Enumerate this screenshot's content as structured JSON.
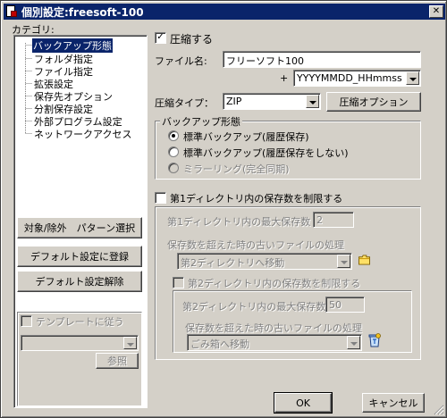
{
  "window": {
    "title": "個別設定:freesoft-100",
    "close_icon": "close-icon"
  },
  "category": {
    "label": "カテゴリ:",
    "items": [
      {
        "label": "バックアップ形態",
        "selected": true
      },
      {
        "label": "フォルダ指定"
      },
      {
        "label": "ファイル指定"
      },
      {
        "label": "拡張設定"
      },
      {
        "label": "保存先オプション"
      },
      {
        "label": "分割保存設定"
      },
      {
        "label": "外部プログラム設定"
      },
      {
        "label": "ネットワークアクセス"
      }
    ]
  },
  "left_buttons": {
    "pattern": "対象/除外　パターン選択",
    "register_default": "デフォルト設定に登録",
    "clear_default": "デフォルト設定解除"
  },
  "template": {
    "checkbox_label": "テンプレートに従う",
    "ref_button": "参照"
  },
  "compress": {
    "label": "圧縮する",
    "checked": true
  },
  "filename": {
    "label": "ファイル名:",
    "value": "フリーソフト100",
    "plus": "+",
    "date_format": "YYYYMMDD_HHmmss"
  },
  "compress_type": {
    "label": "圧縮タイプ：",
    "value": "ZIP",
    "options_button": "圧縮オプション"
  },
  "backup_mode": {
    "title": "バックアップ形態",
    "options": [
      {
        "label": "標準バックアップ(履歴保存)",
        "selected": true,
        "enabled": true
      },
      {
        "label": "標準バックアップ(履歴保存をしない)",
        "selected": false,
        "enabled": true
      },
      {
        "label": "ミラーリング(完全同期)",
        "selected": false,
        "enabled": false
      }
    ]
  },
  "limit1": {
    "checkbox_label": "第1ディレクトリ内の保存数を制限する",
    "max_label": "第1ディレクトリ内の最大保存数",
    "max_value": "2",
    "over_label": "保存数を超えた時の古いファイルの処理",
    "over_value": "第2ディレクトリへ移動",
    "folder_icon": "folder-icon"
  },
  "limit2": {
    "checkbox_label": "第2ディレクトリ内の保存数を制限する",
    "max_label": "第2ディレクトリ内の最大保存数",
    "max_value": "50",
    "over_label": "保存数を超えた時の古いファイルの処理",
    "over_value": "ごみ箱へ移動",
    "recycle_icon": "recycle-bin-icon"
  },
  "footer": {
    "ok": "OK",
    "cancel": "キャンセル"
  }
}
